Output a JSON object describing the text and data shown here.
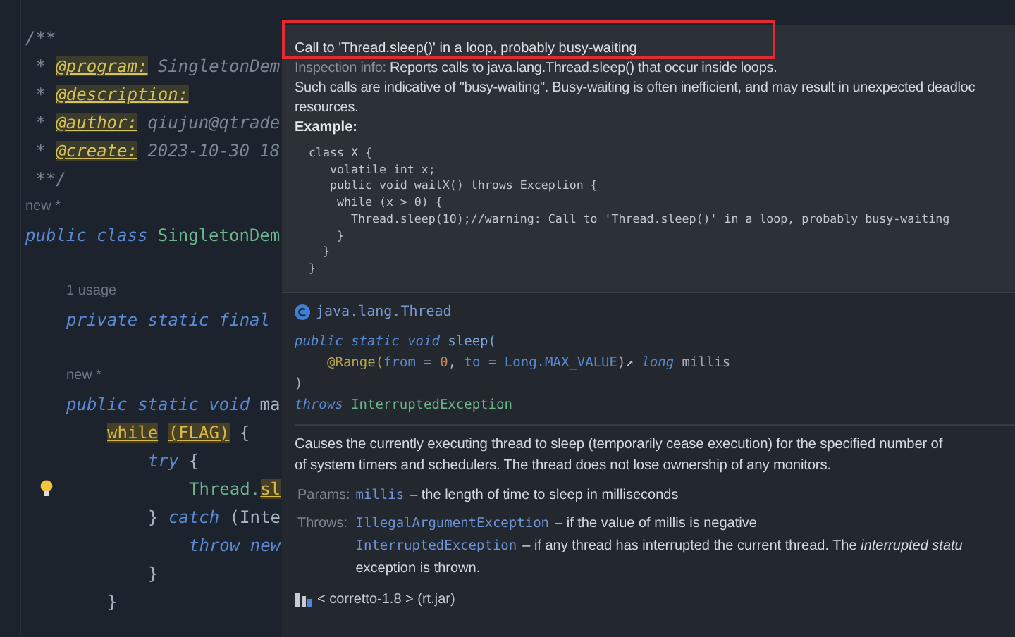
{
  "editor": {
    "lines": [
      {
        "kind": "code",
        "tokens": [
          {
            "kind": "comment",
            "text": "/**"
          }
        ]
      },
      {
        "kind": "code",
        "tokens": [
          {
            "kind": "comment",
            "text": " * "
          },
          {
            "kind": "tag",
            "text": "@program:"
          },
          {
            "kind": "comment",
            "text": " SingletonDem"
          }
        ]
      },
      {
        "kind": "code",
        "tokens": [
          {
            "kind": "comment",
            "text": " * "
          },
          {
            "kind": "tag",
            "text": "@description:"
          }
        ]
      },
      {
        "kind": "code",
        "tokens": [
          {
            "kind": "comment",
            "text": " * "
          },
          {
            "kind": "tag",
            "text": "@author:"
          },
          {
            "kind": "comment",
            "text": " qiujun@qtrade"
          }
        ]
      },
      {
        "kind": "code",
        "tokens": [
          {
            "kind": "comment",
            "text": " * "
          },
          {
            "kind": "tag",
            "text": "@create:"
          },
          {
            "kind": "comment",
            "text": " 2023-10-30 18"
          }
        ]
      },
      {
        "kind": "code",
        "tokens": [
          {
            "kind": "comment",
            "text": " **/"
          }
        ]
      },
      {
        "kind": "hint",
        "text": "new *"
      },
      {
        "kind": "code",
        "tokens": [
          {
            "kind": "keyword",
            "text": "public class "
          },
          {
            "kind": "type",
            "text": "SingletonDem"
          }
        ],
        "children": [
          {
            "kind": "blank"
          },
          {
            "kind": "hint",
            "text": "1 usage"
          },
          {
            "kind": "code",
            "tokens": [
              {
                "kind": "keyword",
                "text": "private static final"
              }
            ]
          },
          {
            "kind": "blank"
          },
          {
            "kind": "hint",
            "text": "new *"
          },
          {
            "kind": "code",
            "tokens": [
              {
                "kind": "keyword",
                "text": "public static void "
              },
              {
                "kind": "plain",
                "text": "ma"
              }
            ],
            "children": [
              {
                "kind": "code",
                "tokens": [
                  {
                    "kind": "match",
                    "text": "while"
                  },
                  {
                    "kind": "match",
                    "text": "(FLAG)",
                    "space_before": true
                  },
                  {
                    "kind": "plain",
                    "text": " {"
                  }
                ],
                "children": [
                  {
                    "kind": "code",
                    "tokens": [
                      {
                        "kind": "keyword",
                        "text": "try"
                      },
                      {
                        "kind": "plain",
                        "text": " {"
                      }
                    ],
                    "children": [
                      {
                        "kind": "code",
                        "bulb": true,
                        "tokens": [
                          {
                            "kind": "type",
                            "text": "Thread."
                          },
                          {
                            "kind": "match",
                            "text": "sl"
                          }
                        ]
                      }
                    ]
                  },
                  {
                    "kind": "code",
                    "tokens": [
                      {
                        "kind": "plain",
                        "text": "} "
                      },
                      {
                        "kind": "keyword",
                        "text": "catch"
                      },
                      {
                        "kind": "plain",
                        "text": " (Inte"
                      }
                    ],
                    "children": [
                      {
                        "kind": "code",
                        "tokens": [
                          {
                            "kind": "keyword",
                            "text": "throw new"
                          }
                        ]
                      }
                    ]
                  },
                  {
                    "kind": "code",
                    "tokens": [
                      {
                        "kind": "plain",
                        "text": "}"
                      }
                    ]
                  }
                ]
              },
              {
                "kind": "code",
                "tokens": [
                  {
                    "kind": "plain",
                    "text": "}"
                  }
                ]
              }
            ]
          }
        ]
      }
    ]
  },
  "popup": {
    "inspection": {
      "title": "Call to 'Thread.sleep()' in a loop, probably busy-waiting",
      "info_label": "Inspection info:",
      "info_text": "Reports calls to java.lang.Thread.sleep() that occur inside loops.",
      "description_lines": [
        "Such calls are indicative of \"busy-waiting\". Busy-waiting is often inefficient, and may result in unexpected deadloc",
        "resources."
      ],
      "example_heading": "Example:",
      "example_code": [
        "class X {",
        "   volatile int x;",
        "   public void waitX() throws Exception {",
        "    while (x > 0) {",
        "      Thread.sleep(10);//warning: Call to 'Thread.sleep()' in a loop, probably busy-waiting",
        "    }",
        "  }",
        "}"
      ]
    },
    "documentation": {
      "class_name": "java.lang.Thread",
      "signature": [
        {
          "tokens": [
            {
              "kind": "keyword",
              "text": "public static void "
            },
            {
              "kind": "method",
              "text": "sleep("
            }
          ],
          "children": [
            {
              "tokens": [
                {
                  "kind": "annotation",
                  "text": "@Range("
                },
                {
                  "kind": "param",
                  "text": "from"
                },
                {
                  "kind": "plain",
                  "text": " = "
                },
                {
                  "kind": "number",
                  "text": "0"
                },
                {
                  "kind": "plain",
                  "text": ", "
                },
                {
                  "kind": "param",
                  "text": "to"
                },
                {
                  "kind": "plain",
                  "text": " = "
                },
                {
                  "kind": "param",
                  "text": "Long.MAX_VALUE"
                },
                {
                  "kind": "plain",
                  "text": ")"
                },
                {
                  "kind": "link",
                  "text": "↗ "
                },
                {
                  "kind": "keyword",
                  "text": "long"
                },
                {
                  "kind": "plain",
                  "text": " millis"
                }
              ]
            }
          ]
        },
        {
          "tokens": [
            {
              "kind": "plain",
              "text": ")"
            }
          ]
        },
        {
          "tokens": [
            {
              "kind": "keyword",
              "text": "throws "
            },
            {
              "kind": "type",
              "text": "InterruptedException"
            }
          ]
        }
      ],
      "description_lines": [
        "Causes the currently executing thread to sleep (temporarily cease execution) for the specified number of",
        "of system timers and schedulers. The thread does not lose ownership of any monitors."
      ],
      "params_label": "Params:",
      "params": [
        {
          "name": "millis",
          "lines": [
            "– the length of time to sleep in milliseconds"
          ]
        }
      ],
      "throws_label": "Throws:",
      "throws": [
        {
          "name": "IllegalArgumentException",
          "lines": [
            "– if the value of millis is negative"
          ]
        },
        {
          "name": "InterruptedException",
          "lines": [
            "– if any thread has interrupted the current thread. The *interrupted statu*",
            "exception is thrown."
          ]
        }
      ],
      "source": "< corretto-1.8 > (rt.jar)"
    }
  }
}
